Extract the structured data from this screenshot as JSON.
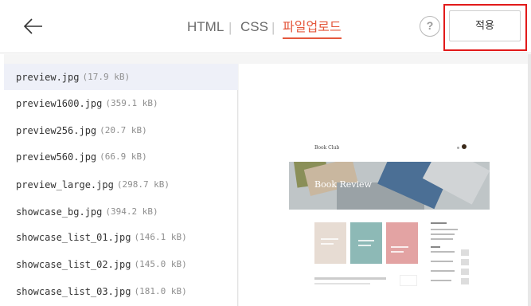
{
  "header": {
    "back_icon": "arrow-left-icon",
    "tabs": [
      {
        "label": "HTML",
        "active": false
      },
      {
        "label": "CSS",
        "active": false
      },
      {
        "label": "파일업로드",
        "active": true
      }
    ],
    "separator": "|",
    "help_label": "?",
    "apply_label": "적용",
    "accent_color": "#e4583d",
    "highlight_color": "#e21a1a"
  },
  "files": [
    {
      "name": "preview.jpg",
      "size": "(17.9 kB)",
      "selected": true
    },
    {
      "name": "preview1600.jpg",
      "size": "(359.1 kB)",
      "selected": false
    },
    {
      "name": "preview256.jpg",
      "size": "(20.7 kB)",
      "selected": false
    },
    {
      "name": "preview560.jpg",
      "size": "(66.9 kB)",
      "selected": false
    },
    {
      "name": "preview_large.jpg",
      "size": "(298.7 kB)",
      "selected": false
    },
    {
      "name": "showcase_bg.jpg",
      "size": "(394.2 kB)",
      "selected": false
    },
    {
      "name": "showcase_list_01.jpg",
      "size": "(146.1 kB)",
      "selected": false
    },
    {
      "name": "showcase_list_02.jpg",
      "size": "(145.0 kB)",
      "selected": false
    },
    {
      "name": "showcase_list_03.jpg",
      "size": "(181.0 kB)",
      "selected": false
    }
  ],
  "preview": {
    "brand": "Book Club",
    "hero_title": "Book Review"
  }
}
